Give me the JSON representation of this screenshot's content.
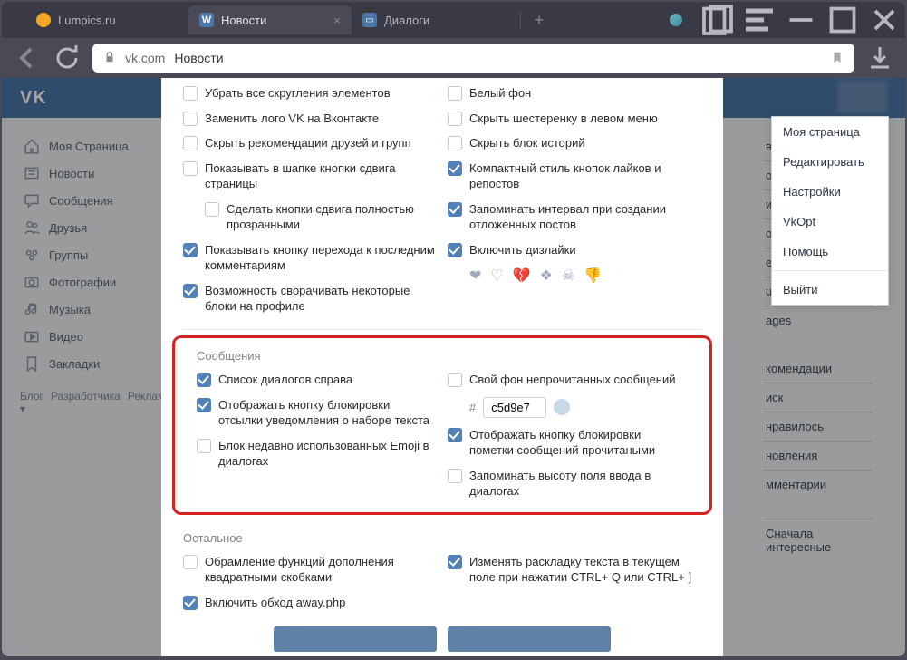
{
  "tabs": [
    {
      "icon_color": "#f5a623",
      "label": "Lumpics.ru",
      "active": false
    },
    {
      "icon_color": "#4a76a8",
      "icon_text": "W",
      "label": "Новости",
      "active": true
    },
    {
      "icon_color": "#4a76a8",
      "icon_text": "💬",
      "label": "Диалоги",
      "active": false
    }
  ],
  "address": {
    "host": "vk.com",
    "query": "Новости"
  },
  "vk_logo": "VK",
  "sidebar": {
    "items": [
      {
        "icon": "home",
        "label": "Моя Страница"
      },
      {
        "icon": "news",
        "label": "Новости"
      },
      {
        "icon": "msg",
        "label": "Сообщения"
      },
      {
        "icon": "friends",
        "label": "Друзья"
      },
      {
        "icon": "groups",
        "label": "Группы"
      },
      {
        "icon": "photo",
        "label": "Фотографии"
      },
      {
        "icon": "music",
        "label": "Музыка"
      },
      {
        "icon": "video",
        "label": "Видео"
      },
      {
        "icon": "bookmark",
        "label": "Закладки"
      }
    ],
    "footer": [
      "Блог",
      "Разработчика",
      "Реклама",
      "Ещё ▾"
    ]
  },
  "right": {
    "top": [
      "вости",
      "отогра",
      "идеоз",
      "одкас",
      "ews",
      "usic",
      "ages"
    ],
    "bottom": [
      "комендации",
      "иск",
      "нравилось",
      "новления",
      "мментарии"
    ],
    "final": "Сначала интересные"
  },
  "dropdown": [
    "Моя страница",
    "Редактировать",
    "Настройки",
    "VkOpt",
    "Помощь",
    "Выйти"
  ],
  "opts": {
    "left1": [
      {
        "c": false,
        "t": "Убрать все скругления элементов"
      },
      {
        "c": false,
        "t": "Заменить лого VK на Вконтакте"
      },
      {
        "c": false,
        "t": "Скрыть рекомендации друзей и групп"
      },
      {
        "c": false,
        "t": "Показывать в шапке кнопки сдвига страницы"
      },
      {
        "c": false,
        "t": "Сделать кнопки сдвига полностью прозрачными",
        "indent": true
      },
      {
        "c": true,
        "t": "Показывать кнопку перехода к последним комментариям"
      },
      {
        "c": true,
        "t": "Возможность сворачивать некоторые блоки на профиле"
      }
    ],
    "right1": [
      {
        "c": false,
        "t": "Белый фон"
      },
      {
        "c": false,
        "t": "Скрыть шестеренку в левом меню"
      },
      {
        "c": false,
        "t": "Скрыть блок историй"
      },
      {
        "c": true,
        "t": "Компактный стиль кнопок лайков и репостов"
      },
      {
        "c": true,
        "t": "Запоминать интервал при создании отложенных постов"
      },
      {
        "c": true,
        "t": "Включить дизлайки"
      }
    ],
    "sec_messages": "Сообщения",
    "left2": [
      {
        "c": true,
        "t": "Список диалогов справа"
      },
      {
        "c": true,
        "t": "Отображать кнопку блокировки отсылки уведомления о наборе текста"
      },
      {
        "c": false,
        "t": "Блок недавно использованных Emoji в диалогах"
      }
    ],
    "right2": [
      {
        "c": false,
        "t": "Свой фон непрочитанных сообщений"
      },
      {
        "hex": "c5d9e7"
      },
      {
        "c": true,
        "t": "Отображать кнопку блокировки пометки сообщений прочитаными"
      },
      {
        "c": false,
        "t": "Запоминать высоту поля ввода в диалогах"
      }
    ],
    "sec_other": "Остальное",
    "left3": [
      {
        "c": false,
        "t": "Обрамление функций дополнения квадратными скобками"
      },
      {
        "c": true,
        "t": "Включить обход away.php"
      }
    ],
    "right3": [
      {
        "c": true,
        "t": "Изменять раскладку текста в текущем поле при нажатии CTRL+ Q или CTRL+ ]"
      }
    ]
  }
}
